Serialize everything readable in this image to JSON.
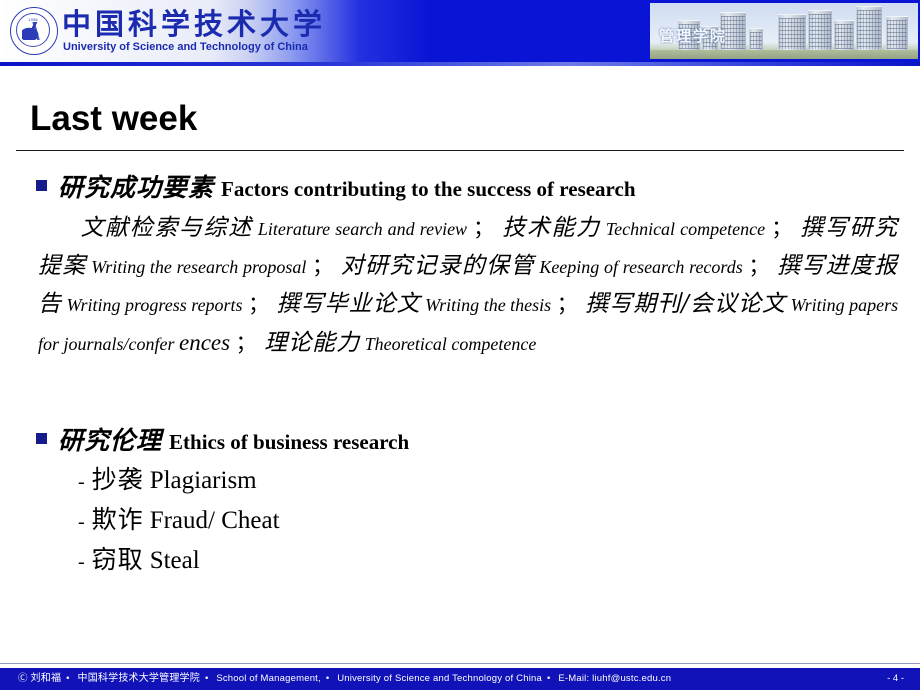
{
  "header": {
    "logo_cn": "中国科学技术大学",
    "logo_en": "University of Science and Technology of China",
    "seal_year": "1958",
    "school_label": "管理学院"
  },
  "title": "Last week",
  "sections": [
    {
      "bullet_cn": "研究成功要素",
      "bullet_en": "Factors contributing to the success of research",
      "paragraph": [
        {
          "type": "indent"
        },
        {
          "type": "cn",
          "text": "文献检索与综述"
        },
        {
          "type": "en",
          "text": "Literature search and review"
        },
        {
          "type": "sep",
          "text": "；"
        },
        {
          "type": "cn",
          "text": "技术能力"
        },
        {
          "type": "en",
          "text": "Technical competence"
        },
        {
          "type": "sep",
          "text": "；"
        },
        {
          "type": "cn",
          "text": "撰写研究提案"
        },
        {
          "type": "en",
          "text": "Writing the research proposal"
        },
        {
          "type": "sep",
          "text": "；"
        },
        {
          "type": "cn",
          "text": "对研究记录的保管"
        },
        {
          "type": "en",
          "text": "Keeping of research records"
        },
        {
          "type": "sep",
          "text": "；"
        },
        {
          "type": "cn",
          "text": "撰写进度报告"
        },
        {
          "type": "en",
          "text": "Writing progress reports"
        },
        {
          "type": "sep",
          "text": "；"
        },
        {
          "type": "cn",
          "text": "撰写毕业论文"
        },
        {
          "type": "en",
          "text": "Writing the thesis"
        },
        {
          "type": "sep",
          "text": "；"
        },
        {
          "type": "cn",
          "text": "撰写期刊/会议论文"
        },
        {
          "type": "en",
          "text": "Writing papers for journals/confer"
        },
        {
          "type": "en-big",
          "text": "ences"
        },
        {
          "type": "sep",
          "text": "；"
        },
        {
          "type": "cn",
          "text": "理论能力"
        },
        {
          "type": "en",
          "text": "Theoretical competence"
        }
      ]
    },
    {
      "bullet_cn": "研究伦理",
      "bullet_en": "Ethics of business research",
      "sub_items": [
        {
          "dash": "-",
          "cn": "抄袭",
          "en": "Plagiarism"
        },
        {
          "dash": "-",
          "cn": "欺诈",
          "en": "Fraud/ Cheat"
        },
        {
          "dash": "-",
          "cn": "窃取",
          "en": "Steal"
        }
      ]
    }
  ],
  "footer": {
    "copyright_symbol": "Ⓒ",
    "author": "刘和福",
    "sep": "•",
    "school_cn": "中国科学技术大学管理学院",
    "school_en": "School of Management,",
    "university_en": "University of Science and Technology of China",
    "email_label": "E-Mail:",
    "email": "liuhf@ustc.edu.cn",
    "page": "- 4 -"
  },
  "colors": {
    "banner_blue": "#0a14d4",
    "footer_blue": "#1112b8",
    "bullet_navy": "#151b8d",
    "logo_blue": "#1b2bb0"
  }
}
